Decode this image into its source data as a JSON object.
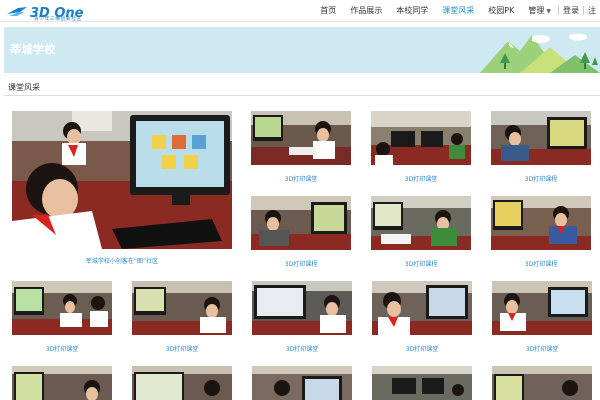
{
  "brand": {
    "name": "3D One",
    "subtitle": "青少年三维创新社区"
  },
  "nav": {
    "items": [
      {
        "label": "首页",
        "active": false
      },
      {
        "label": "作品展示",
        "active": false
      },
      {
        "label": "本校同学",
        "active": false
      },
      {
        "label": "课堂风采",
        "active": true
      },
      {
        "label": "校园PK",
        "active": false
      },
      {
        "label": "管理",
        "active": false
      }
    ],
    "login": "登录",
    "register": "注"
  },
  "banner": {
    "title": "莘城学校"
  },
  "section": {
    "title": "课堂风采"
  },
  "featured": {
    "caption": "莘城学校小创客在“图”社区"
  },
  "gallery": [
    {
      "caption": "3D打印课堂"
    },
    {
      "caption": "3D打印课堂"
    },
    {
      "caption": "3D打印课程"
    },
    {
      "caption": "3D打印课程"
    },
    {
      "caption": "3D打印课程"
    },
    {
      "caption": "3D打印课程"
    },
    {
      "caption": "3D打印课堂"
    },
    {
      "caption": "3D打印课堂"
    },
    {
      "caption": "3D打印课堂"
    },
    {
      "caption": "3D打印课堂"
    },
    {
      "caption": "3D打印课堂"
    }
  ],
  "colors": {
    "accent": "#1a8fd8",
    "banner": "#cfe9f3",
    "caption": "#2a8ad4"
  }
}
